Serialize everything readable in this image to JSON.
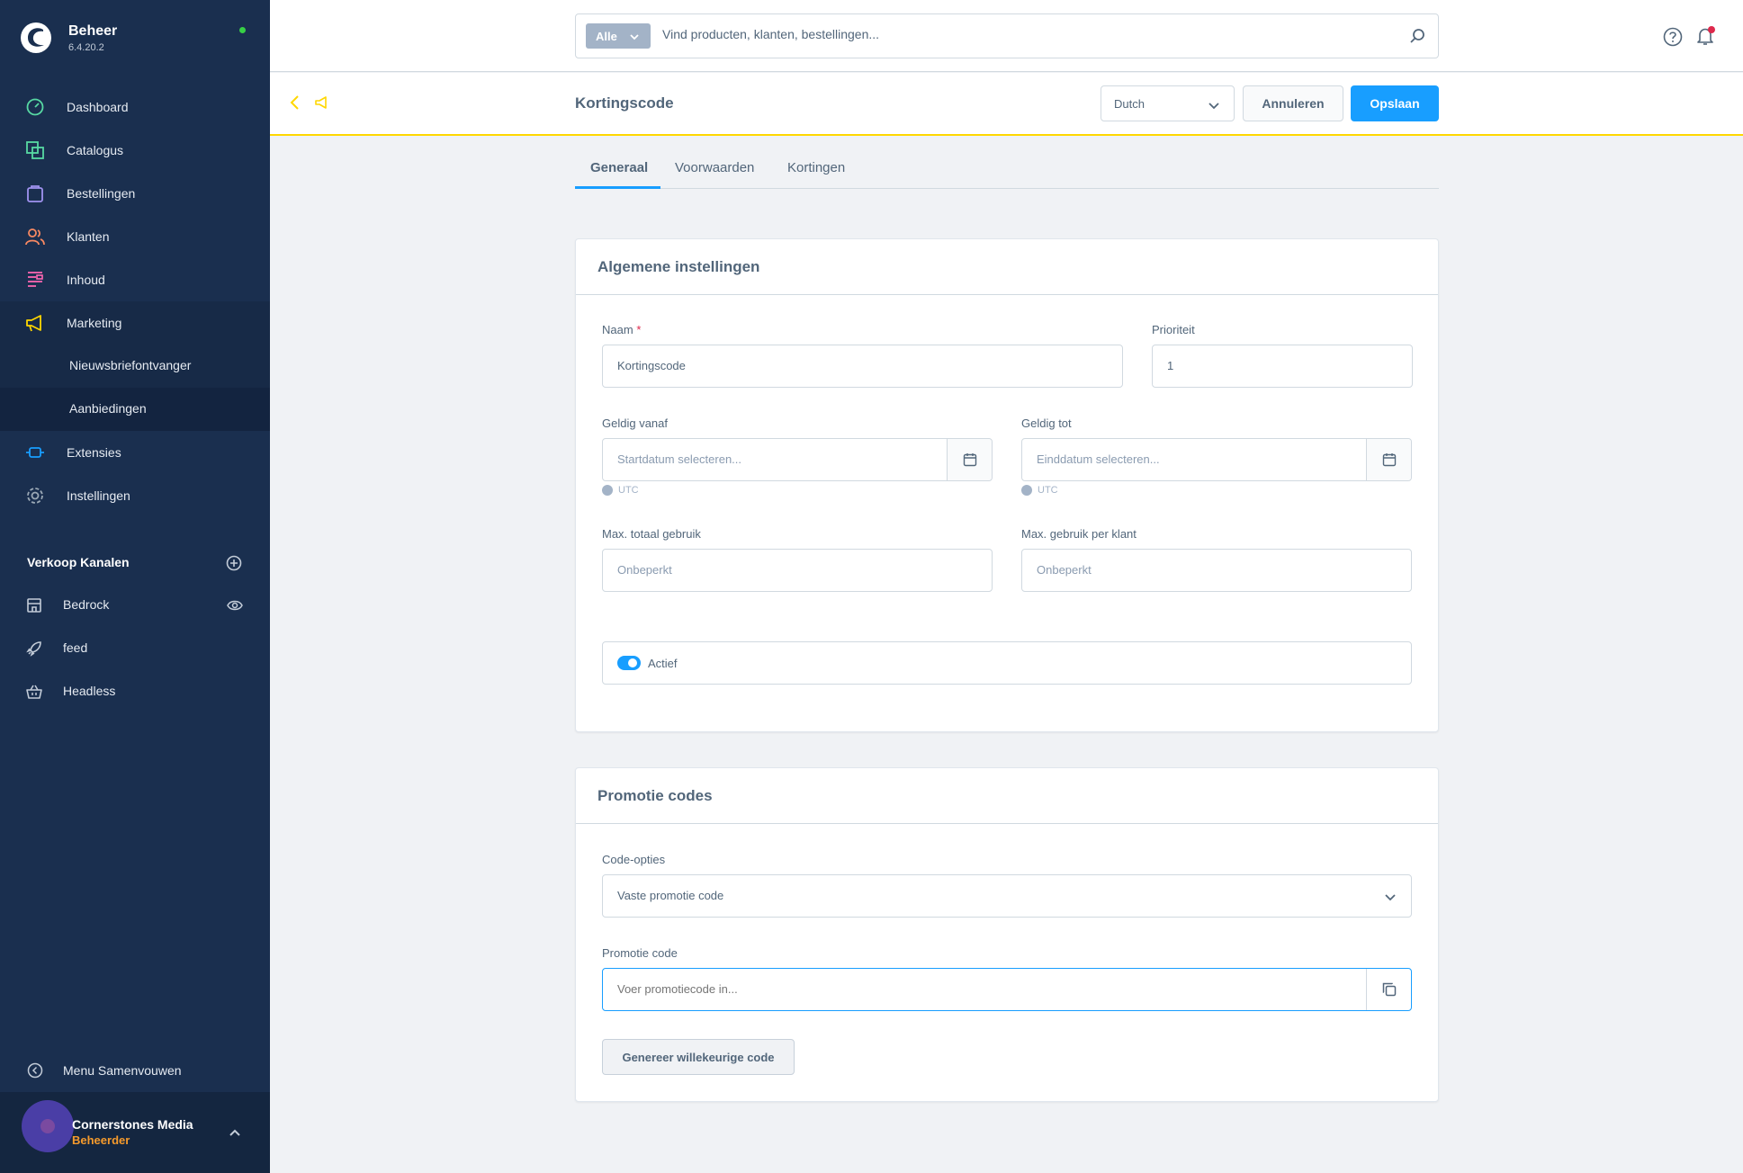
{
  "brand": {
    "name": "Beheer",
    "version": "6.4.20.2"
  },
  "nav": [
    {
      "label": "Dashboard",
      "icon": "dashboard-icon",
      "color": "#57d9a3"
    },
    {
      "label": "Catalogus",
      "icon": "catalog-icon",
      "color": "#57d9a3"
    },
    {
      "label": "Bestellingen",
      "icon": "orders-icon",
      "color": "#a092f0"
    },
    {
      "label": "Klanten",
      "icon": "customers-icon",
      "color": "#f88962"
    },
    {
      "label": "Inhoud",
      "icon": "content-icon",
      "color": "#ff68b4"
    },
    {
      "label": "Marketing",
      "icon": "marketing-icon",
      "color": "#ffd700"
    }
  ],
  "marketing_sub": [
    {
      "label": "Nieuwsbriefontvanger"
    },
    {
      "label": "Aanbiedingen"
    }
  ],
  "nav_bottom": [
    {
      "label": "Extensies",
      "icon": "extensions-icon",
      "color": "#189eff"
    },
    {
      "label": "Instellingen",
      "icon": "settings-icon",
      "color": "#9aa8b5"
    }
  ],
  "channels": {
    "title": "Verkoop Kanalen",
    "items": [
      {
        "label": "Bedrock"
      },
      {
        "label": "feed"
      },
      {
        "label": "Headless"
      }
    ]
  },
  "collapse_label": "Menu Samenvouwen",
  "user": {
    "name": "Cornerstones Media",
    "role": "Beheerder"
  },
  "search": {
    "type_label": "Alle",
    "placeholder": "Vind producten, klanten, bestellingen..."
  },
  "smartbar": {
    "title": "Kortingscode",
    "language": "Dutch",
    "cancel": "Annuleren",
    "save": "Opslaan"
  },
  "tabs": [
    {
      "label": "Generaal"
    },
    {
      "label": "Voorwaarden"
    },
    {
      "label": "Kortingen"
    }
  ],
  "general": {
    "title": "Algemene instellingen",
    "name_label": "Naam",
    "name_required": "*",
    "name_value": "Kortingscode",
    "priority_label": "Prioriteit",
    "priority_value": "1",
    "valid_from_label": "Geldig vanaf",
    "valid_from_placeholder": "Startdatum selecteren...",
    "valid_to_label": "Geldig tot",
    "valid_to_placeholder": "Einddatum selecteren...",
    "timezone": "UTC",
    "max_total_label": "Max. totaal gebruik",
    "max_total_placeholder": "Onbeperkt",
    "max_customer_label": "Max. gebruik per klant",
    "max_customer_placeholder": "Onbeperkt",
    "active_label": "Actief"
  },
  "codes": {
    "title": "Promotie codes",
    "options_label": "Code-opties",
    "options_value": "Vaste promotie code",
    "code_label": "Promotie code",
    "code_placeholder": "Voer promotiecode in...",
    "generate_label": "Genereer willekeurige code"
  }
}
